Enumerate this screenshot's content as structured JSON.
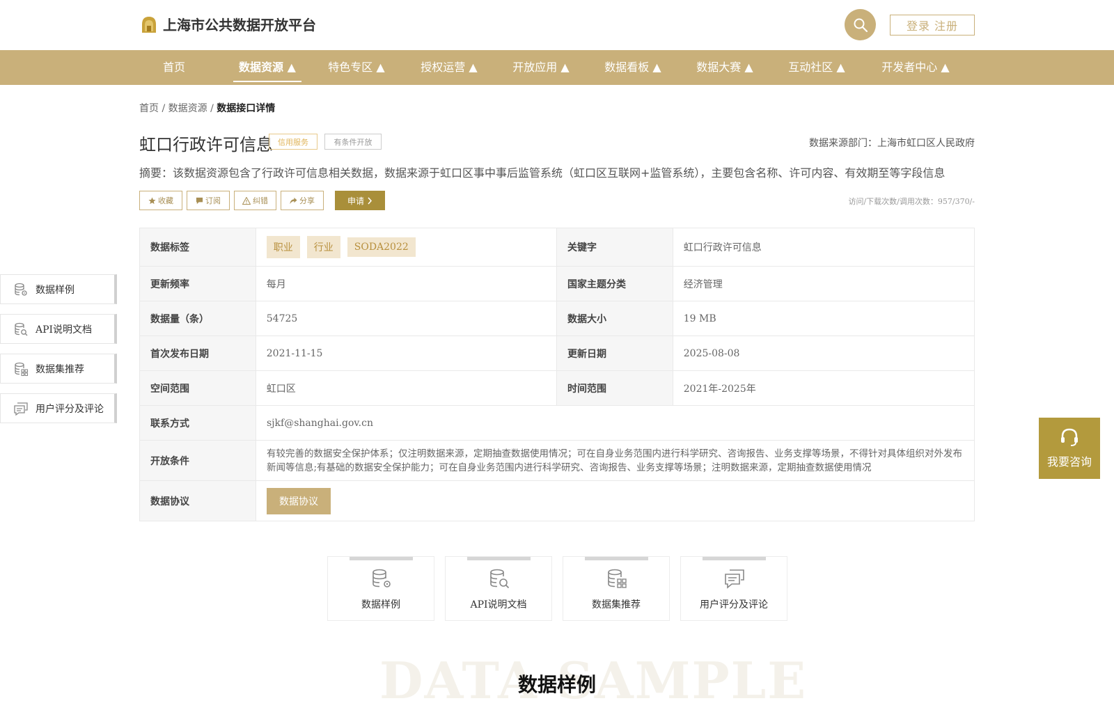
{
  "header": {
    "logo_title": "上海市公共数据开放平台",
    "login_label": "登录 注册",
    "accent": "#c9b07a"
  },
  "nav": {
    "items": [
      {
        "label": "首页"
      },
      {
        "label": "数据资源 ▲",
        "active": true
      },
      {
        "label": "特色专区 ▲"
      },
      {
        "label": "授权运营 ▲"
      },
      {
        "label": "开放应用 ▲"
      },
      {
        "label": "数据看板 ▲"
      },
      {
        "label": "数据大赛 ▲"
      },
      {
        "label": "互动社区 ▲"
      },
      {
        "label": "开发者中心 ▲"
      }
    ]
  },
  "breadcrumb": {
    "home": "首页",
    "sep": " / ",
    "resources": "数据资源",
    "current": "数据接口详情"
  },
  "detail": {
    "title": "虹口行政许可信息",
    "tag_credit": "信用服务",
    "tag_open": "有条件开放",
    "source": "数据来源部门：上海市虹口区人民政府",
    "summary": "摘要：该数据资源包含了行政许可信息相关数据，数据来源于虹口区事中事后监管系统（虹口区互联网+监管系统），主要包含名称、许可内容、有效期至等字段信息",
    "actions": {
      "favorite": "收藏",
      "subscribe": "订阅",
      "report": "纠错",
      "share": "分享",
      "apply": "申请"
    },
    "stats": "访问/下载次数/调用次数：957/370/-"
  },
  "table": {
    "tags_label": "数据标签",
    "tags": [
      "职业",
      "行业",
      "SODA2022"
    ],
    "keyword_label": "关键字",
    "keyword": "虹口行政许可信息",
    "freq_label": "更新频率",
    "freq": "每月",
    "theme_label": "国家主题分类",
    "theme": "经济管理",
    "count_label": "数据量（条）",
    "count": "54725",
    "size_label": "数据大小",
    "size": "19 MB",
    "first_label": "首次发布日期",
    "first": "2021-11-15",
    "update_label": "更新日期",
    "update": "2025-08-08",
    "space_label": "空间范围",
    "space": "虹口区",
    "time_label": "时间范围",
    "time": "2021年-2025年",
    "contact_label": "联系方式",
    "contact": "sjkf@shanghai.gov.cn",
    "cond_label": "开放条件",
    "cond": "有较完善的数据安全保护体系；仅注明数据来源，定期抽查数据使用情况；可在自身业务范围内进行科学研究、咨询报告、业务支撑等场景，不得针对具体组织对外发布新闻等信息;有基础的数据安全保护能力；可在自身业务范围内进行科学研究、咨询报告、业务支撑等场景；注明数据来源，定期抽查数据使用情况",
    "agreement_label": "数据协议",
    "agreement_btn": "数据协议"
  },
  "sidebar": {
    "items": [
      {
        "label": "数据样例",
        "icon": "database-gear-icon"
      },
      {
        "label": "API说明文档",
        "icon": "database-search-icon"
      },
      {
        "label": "数据集推荐",
        "icon": "database-grid-icon"
      },
      {
        "label": "用户评分及评论",
        "icon": "comment-icon"
      }
    ]
  },
  "cards": [
    {
      "label": "数据样例"
    },
    {
      "label": "API说明文档"
    },
    {
      "label": "数据集推荐"
    },
    {
      "label": "用户评分及评论"
    }
  ],
  "consult_label": "我要咨询",
  "section": {
    "bg_word": "DATA SAMPLE",
    "title": "数据样例"
  }
}
